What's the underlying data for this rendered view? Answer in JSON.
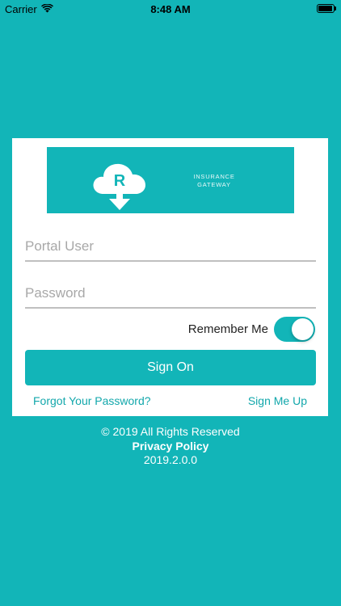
{
  "status_bar": {
    "carrier": "Carrier",
    "time": "8:48 AM"
  },
  "logo": {
    "letter": "R",
    "text_line1": "INSURANCE",
    "text_line2": "GATEWAY"
  },
  "login": {
    "username_placeholder": "Portal User",
    "username_value": "",
    "password_placeholder": "Password",
    "password_value": "",
    "remember_label": "Remember Me",
    "remember_on": true,
    "sign_on_label": "Sign On",
    "forgot_label": "Forgot Your Password?",
    "signup_label": "Sign Me Up"
  },
  "footer": {
    "copyright": "© 2019 All Rights Reserved",
    "privacy": "Privacy Policy",
    "version": "2019.2.0.0"
  },
  "colors": {
    "brand": "#12b5b8",
    "card": "#ffffff"
  },
  "icons": {
    "signal": "wifi-icon",
    "battery": "battery-icon",
    "logo": "cloud-download-icon"
  }
}
